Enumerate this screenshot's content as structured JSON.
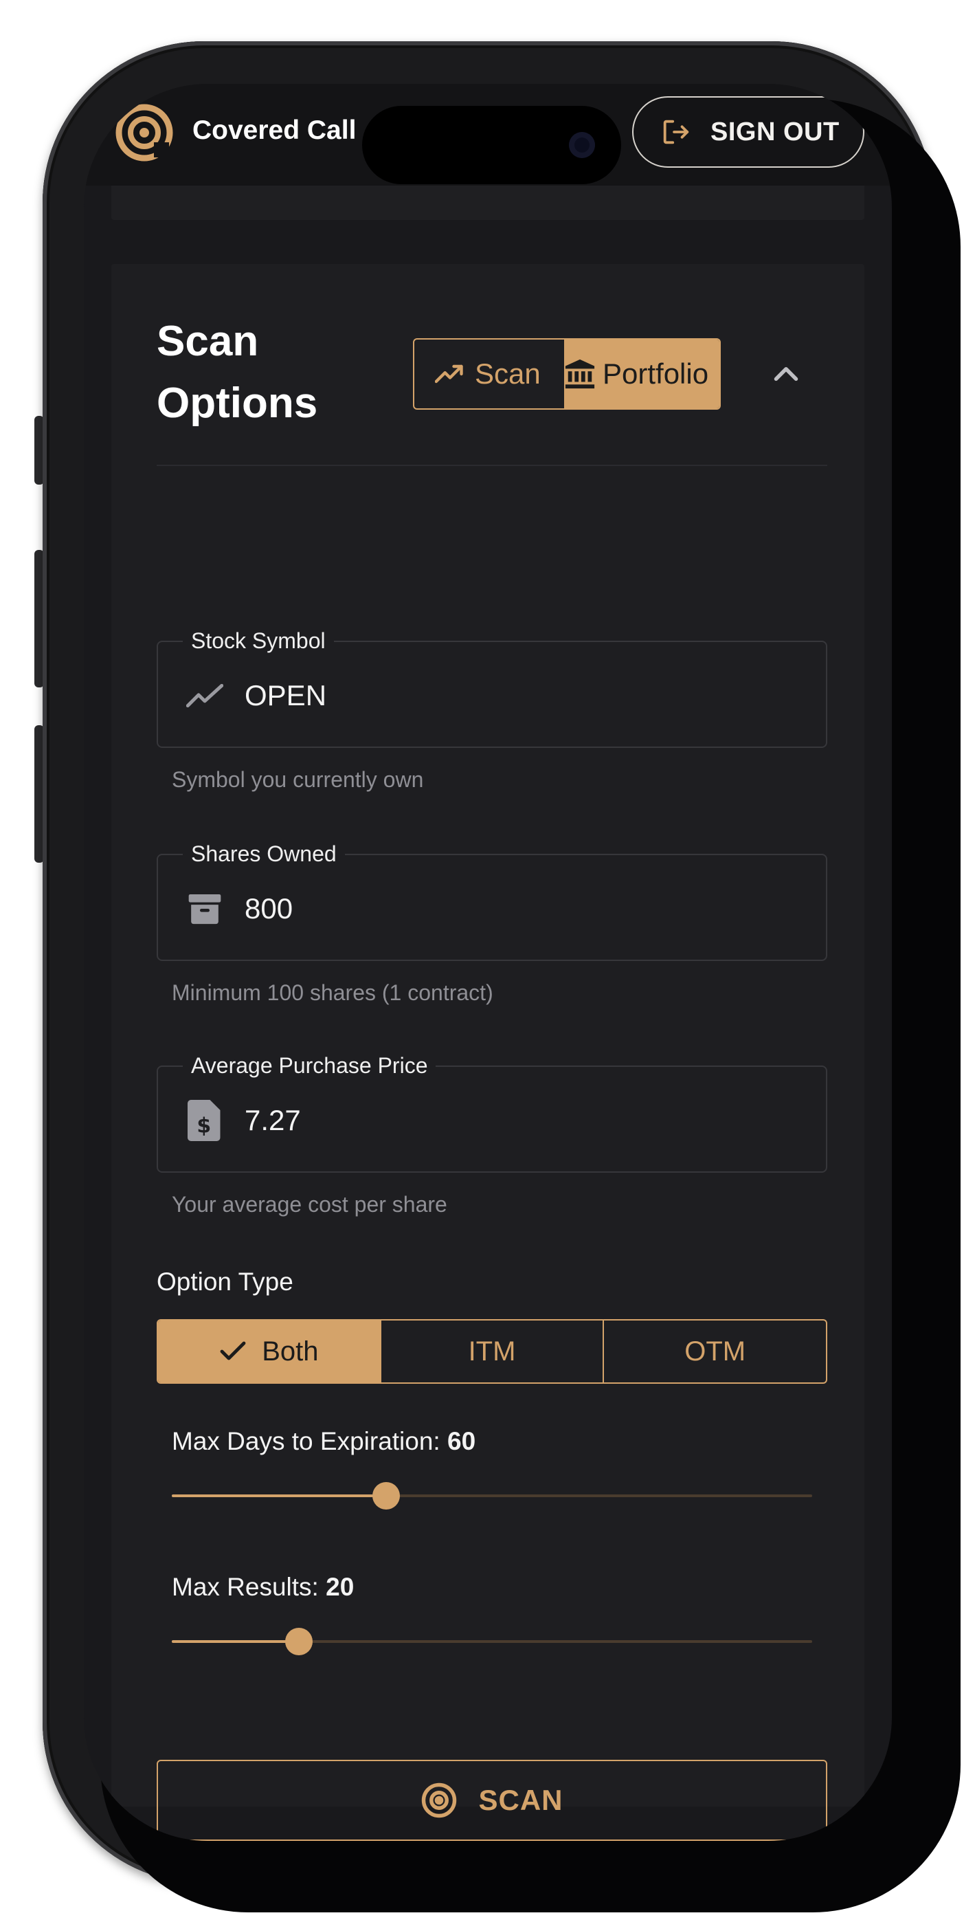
{
  "header": {
    "app_title": "Covered Call",
    "sign_out_label": "SIGN OUT"
  },
  "scan_options": {
    "title": "Scan\nOptions",
    "mode_toggle": {
      "scan_label": "Scan",
      "portfolio_label": "Portfolio",
      "selected": "Portfolio"
    },
    "fields": {
      "stock_symbol": {
        "label": "Stock Symbol",
        "value": "OPEN",
        "helper": "Symbol you currently own",
        "icon": "trending-up-icon"
      },
      "shares_owned": {
        "label": "Shares Owned",
        "value": "800",
        "helper": "Minimum 100 shares (1 contract)",
        "icon": "archive-box-icon"
      },
      "avg_price": {
        "label": "Average Purchase Price",
        "value": "7.27",
        "helper": "Your average cost per share",
        "icon": "receipt-dollar-icon"
      }
    },
    "option_type": {
      "label": "Option Type",
      "options": [
        "Both",
        "ITM",
        "OTM"
      ],
      "selected": "Both"
    },
    "max_days": {
      "label": "Max Days to Expiration:",
      "value": "60",
      "fraction": 0.335
    },
    "max_results": {
      "label": "Max Results:",
      "value": "20",
      "fraction": 0.198
    },
    "scan_button_label": "SCAN"
  },
  "colors": {
    "accent": "#d4a36a",
    "background": "#19191c",
    "card": "#1e1e21"
  }
}
